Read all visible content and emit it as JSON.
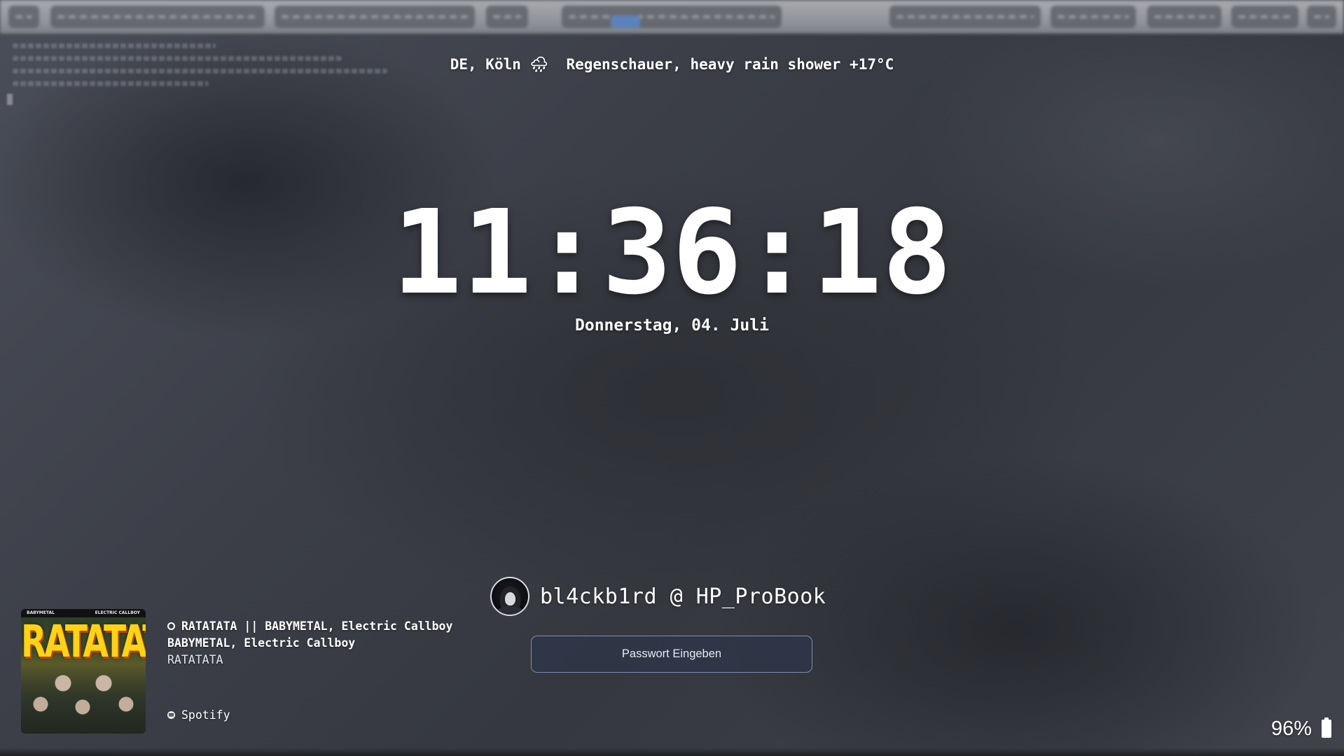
{
  "weather": {
    "text": "DE, Köln 🌧  Regenschauer, heavy rain shower +17°C"
  },
  "clock": {
    "time": "11:36:18",
    "date": "Donnerstag, 04. Juli"
  },
  "user": {
    "label": "bl4ckb1rd @ HP_ProBook"
  },
  "password": {
    "placeholder": "Passwort Eingeben"
  },
  "media": {
    "title_line": "RATATATA || BABYMETAL, Electric Callboy",
    "artist": "BABYMETAL, Electric Callboy",
    "album": "RATATATA",
    "player": "Spotify",
    "cover": {
      "title": "RATATATA",
      "top_left": "BABYMETAL",
      "top_right": "ELECTRIC CALLBOY"
    }
  },
  "battery": {
    "percent": "96%",
    "level": 0.96
  },
  "colors": {
    "password_border": "#7f8fb0",
    "cover_title": "#ffd21a",
    "active_workspace": "#4f7fc4"
  }
}
